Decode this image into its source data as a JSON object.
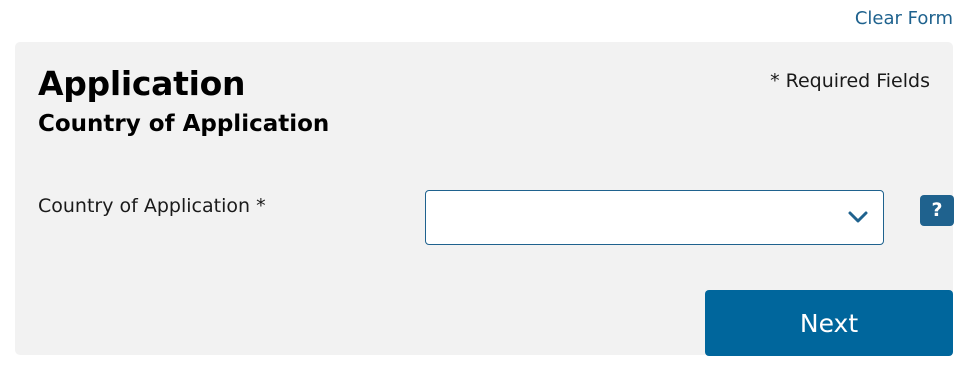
{
  "header": {
    "clear_form_label": "Clear Form"
  },
  "form": {
    "title": "Application",
    "subtitle": "Country of Application",
    "required_note": "* Required Fields",
    "country_field": {
      "label": "Country of Application *",
      "value": ""
    },
    "help_label": "?",
    "next_label": "Next"
  },
  "colors": {
    "accent": "#1f628e",
    "button": "#00669c",
    "panel_background": "#f2f2f2"
  },
  "icons": {
    "select_indicator": "chevron-down-icon",
    "help": "question-mark-icon"
  }
}
